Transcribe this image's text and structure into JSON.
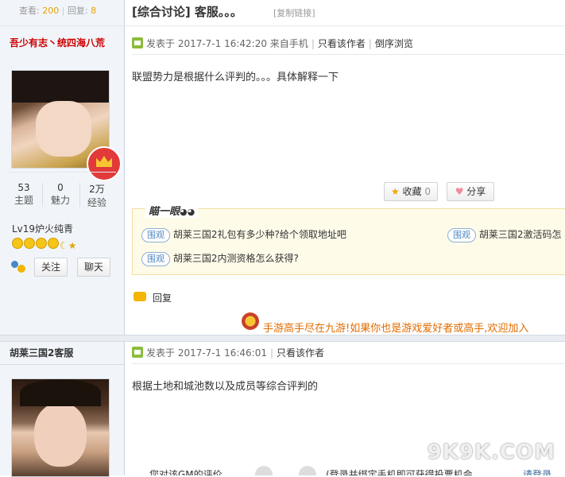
{
  "thread": {
    "views_label": "查看:",
    "views": "200",
    "replies_label": "回复:",
    "replies": "8",
    "separator": "|",
    "title": "[综合讨论] 客服。。。",
    "copy_link": "[复制链接]"
  },
  "post1": {
    "author": "吾少有志丶统四海八荒",
    "stats": [
      {
        "value": "53",
        "label": "主题"
      },
      {
        "value": "0",
        "label": "魅力"
      },
      {
        "value": "2万",
        "label": "经验"
      }
    ],
    "level": "Lv19炉火纯青",
    "follow_label": "关注",
    "chat_label": "聊天",
    "posted": "发表于 2017-7-1 16:42:20 来自手机",
    "only_author": "只看该作者",
    "reverse": "倒序浏览",
    "content": "联盟势力是根据什么评判的。。。具体解释一下",
    "collect_label": "收藏",
    "collect_count": "0",
    "share_label": "分享",
    "related_title": "瞄一眼",
    "related": [
      {
        "tag": "围观",
        "text": "胡莱三国2礼包有多少种?给个领取地址吧"
      },
      {
        "tag": "围观",
        "text": "胡莱三国2激活码怎"
      },
      {
        "tag": "围观",
        "text": "胡莱三国2内测资格怎么获得?"
      }
    ],
    "reply_label": "回复",
    "ad_text": "手游高手尽在九游!如果你也是游戏爱好者或高手,欢迎加入"
  },
  "post2": {
    "author": "胡莱三国2客服",
    "posted": "发表于 2017-7-1 16:46:01",
    "only_author": "只看该作者",
    "content": "根据土地和城池数以及成员等综合评判的",
    "bottom_left": "您对该GM的评价",
    "bottom_mid": "(登录并绑定手机即可获得投票机会",
    "bottom_right": "请登录"
  },
  "watermark": "9K9K.COM"
}
